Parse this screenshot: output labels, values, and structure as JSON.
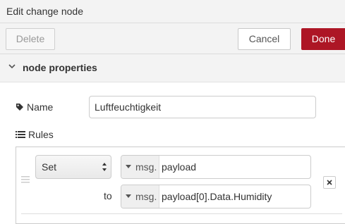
{
  "window": {
    "title": "Edit change node"
  },
  "toolbar": {
    "delete_label": "Delete",
    "cancel_label": "Cancel",
    "done_label": "Done"
  },
  "section": {
    "label": "node properties",
    "icon": "chevron-down-icon"
  },
  "name_field": {
    "label": "Name",
    "icon": "tag-icon",
    "value": "Luftfeuchtigkeit"
  },
  "rules": {
    "label": "Rules",
    "icon": "list-icon",
    "items": [
      {
        "action": "Set",
        "target": {
          "type": "msg.",
          "value": "payload"
        },
        "to_label": "to",
        "source": {
          "type": "msg.",
          "value": "payload[0].Data.Humidity"
        }
      }
    ]
  },
  "colors": {
    "done_button": "#ad1625",
    "header_bg": "#f3f3f3"
  }
}
